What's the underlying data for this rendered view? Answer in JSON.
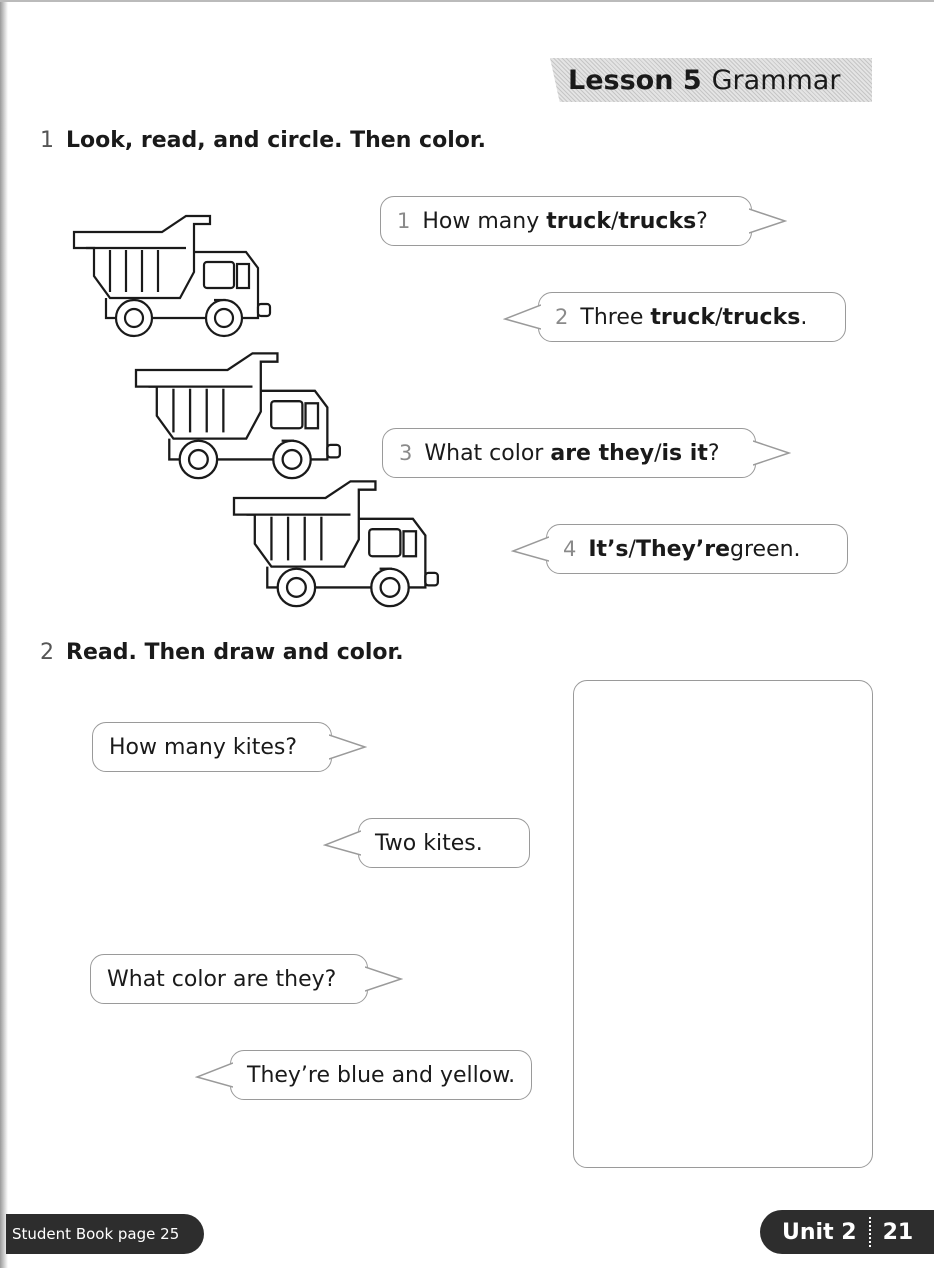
{
  "header": {
    "lesson_label": "Lesson 5",
    "lesson_topic": "Grammar"
  },
  "exercise1": {
    "number": "1",
    "instruction": "Look, read, and circle. Then color.",
    "bubbles": [
      {
        "num": "1",
        "pre": "How many ",
        "choice_a": "truck",
        "slash": " / ",
        "choice_b": "trucks",
        "post": "?"
      },
      {
        "num": "2",
        "pre": "Three ",
        "choice_a": "truck",
        "slash": " / ",
        "choice_b": "trucks",
        "post": "."
      },
      {
        "num": "3",
        "pre": "What color ",
        "choice_a": "are they",
        "slash": " / ",
        "choice_b": "is it",
        "post": "?"
      },
      {
        "num": "4",
        "pre": "",
        "choice_a": "It’s",
        "slash": " / ",
        "choice_b": "They’re",
        "post": " green."
      }
    ],
    "trucks": [
      "dump-truck",
      "dump-truck",
      "dump-truck"
    ]
  },
  "exercise2": {
    "number": "2",
    "instruction": "Read. Then draw and color.",
    "bubbles": [
      "How many kites?",
      "Two kites.",
      "What color are they?",
      "They’re blue and yellow."
    ]
  },
  "footer": {
    "student_book": "Student Book page 25",
    "unit": "Unit 2",
    "page": "21"
  }
}
